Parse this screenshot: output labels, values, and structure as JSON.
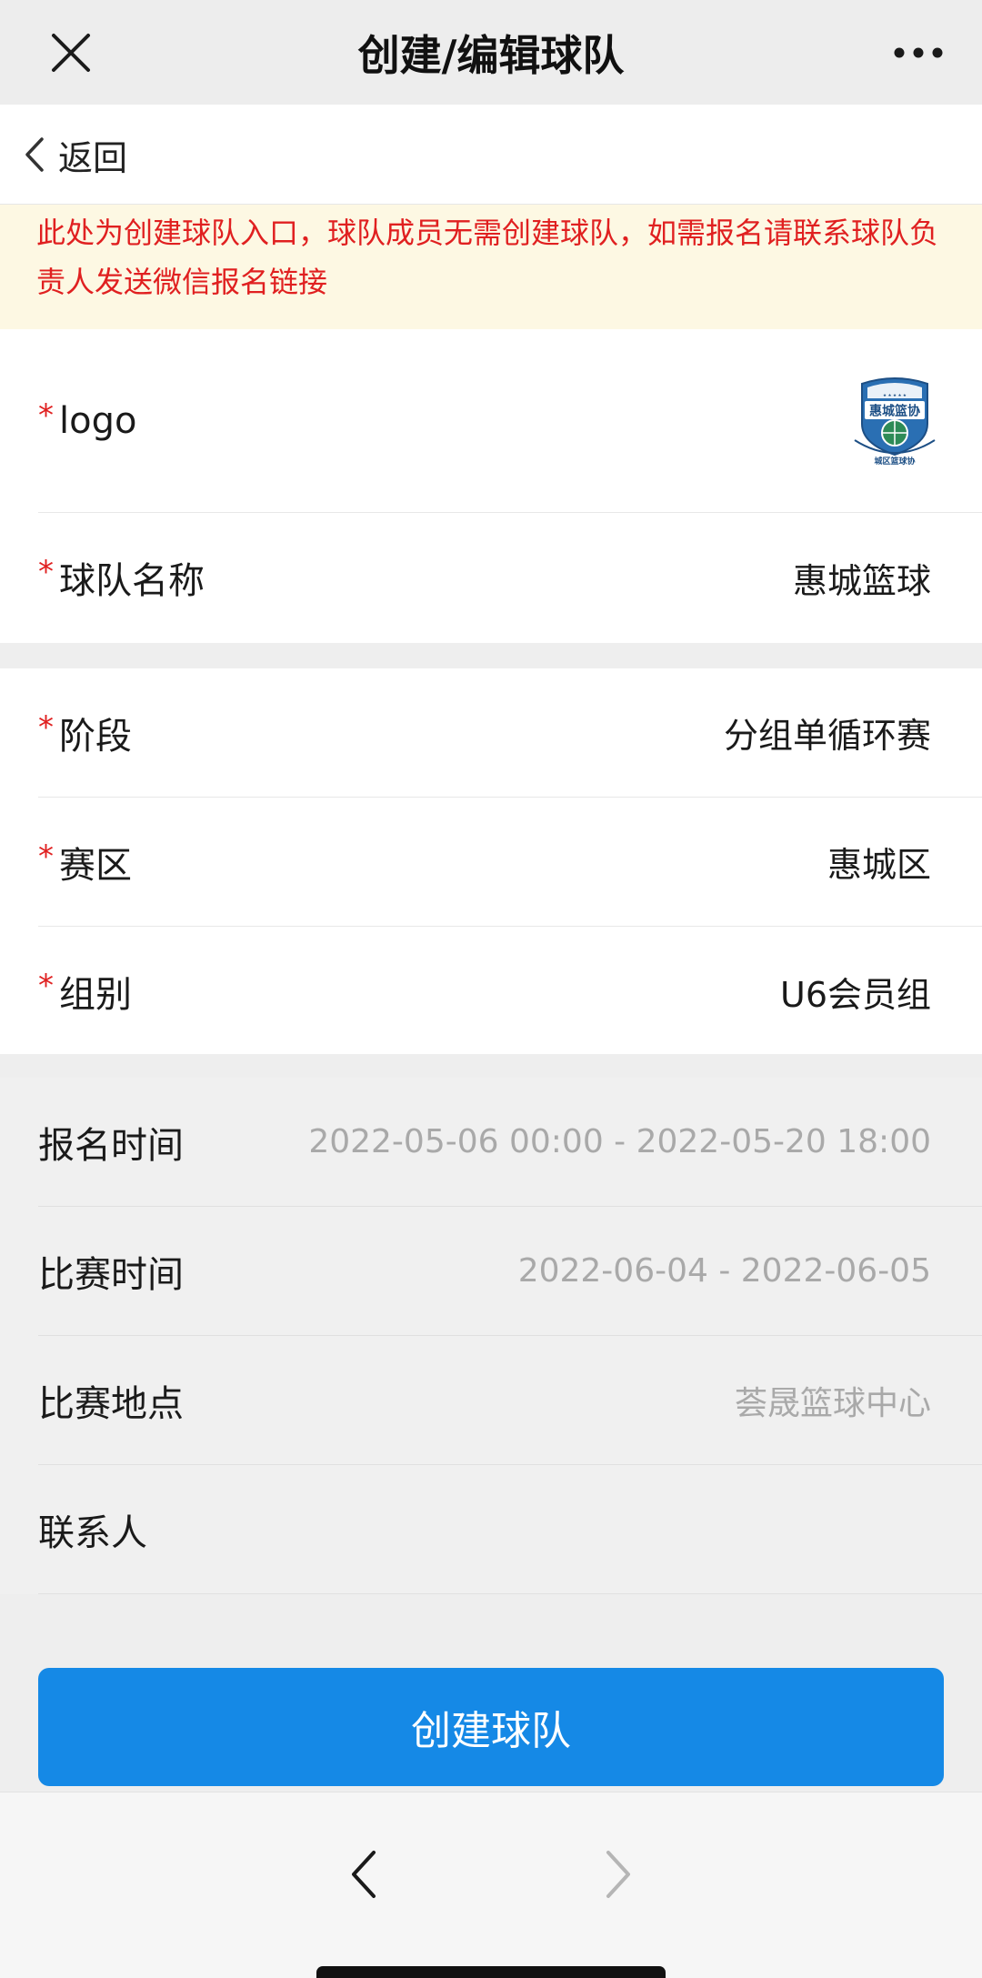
{
  "header": {
    "title": "创建/编辑球队",
    "close_icon": "close-icon",
    "more_icon": "more-dots-icon"
  },
  "nav": {
    "back_label": "返回"
  },
  "notice": {
    "text": "此处为创建球队入口，球队成员无需创建球队，如需报名请联系球队负责人发送微信报名链接",
    "color": "#e02020",
    "background": "#fdf8e3"
  },
  "form": {
    "required_mark": "*",
    "logo": {
      "label": "logo",
      "image_text_top": "惠城篮协",
      "image_text_bottom": "城区篮球协"
    },
    "team_name": {
      "label": "球队名称",
      "value": "惠城篮球"
    },
    "stage": {
      "label": "阶段",
      "value": "分组单循环赛"
    },
    "division": {
      "label": "赛区",
      "value": "惠城区"
    },
    "group": {
      "label": "组别",
      "value": "U6会员组"
    }
  },
  "info": {
    "registration_time": {
      "label": "报名时间",
      "value": "2022-05-06 00:00 - 2022-05-20 18:00"
    },
    "match_time": {
      "label": "比赛时间",
      "value": "2022-06-04 - 2022-06-05"
    },
    "venue": {
      "label": "比赛地点",
      "value": "荟晟篮球中心"
    },
    "contact": {
      "label": "联系人",
      "value": ""
    }
  },
  "actions": {
    "create_label": "创建球队",
    "accent": "#1589e6"
  },
  "bottom_nav": {
    "prev_icon": "chevron-left-icon",
    "next_icon": "chevron-right-icon"
  }
}
